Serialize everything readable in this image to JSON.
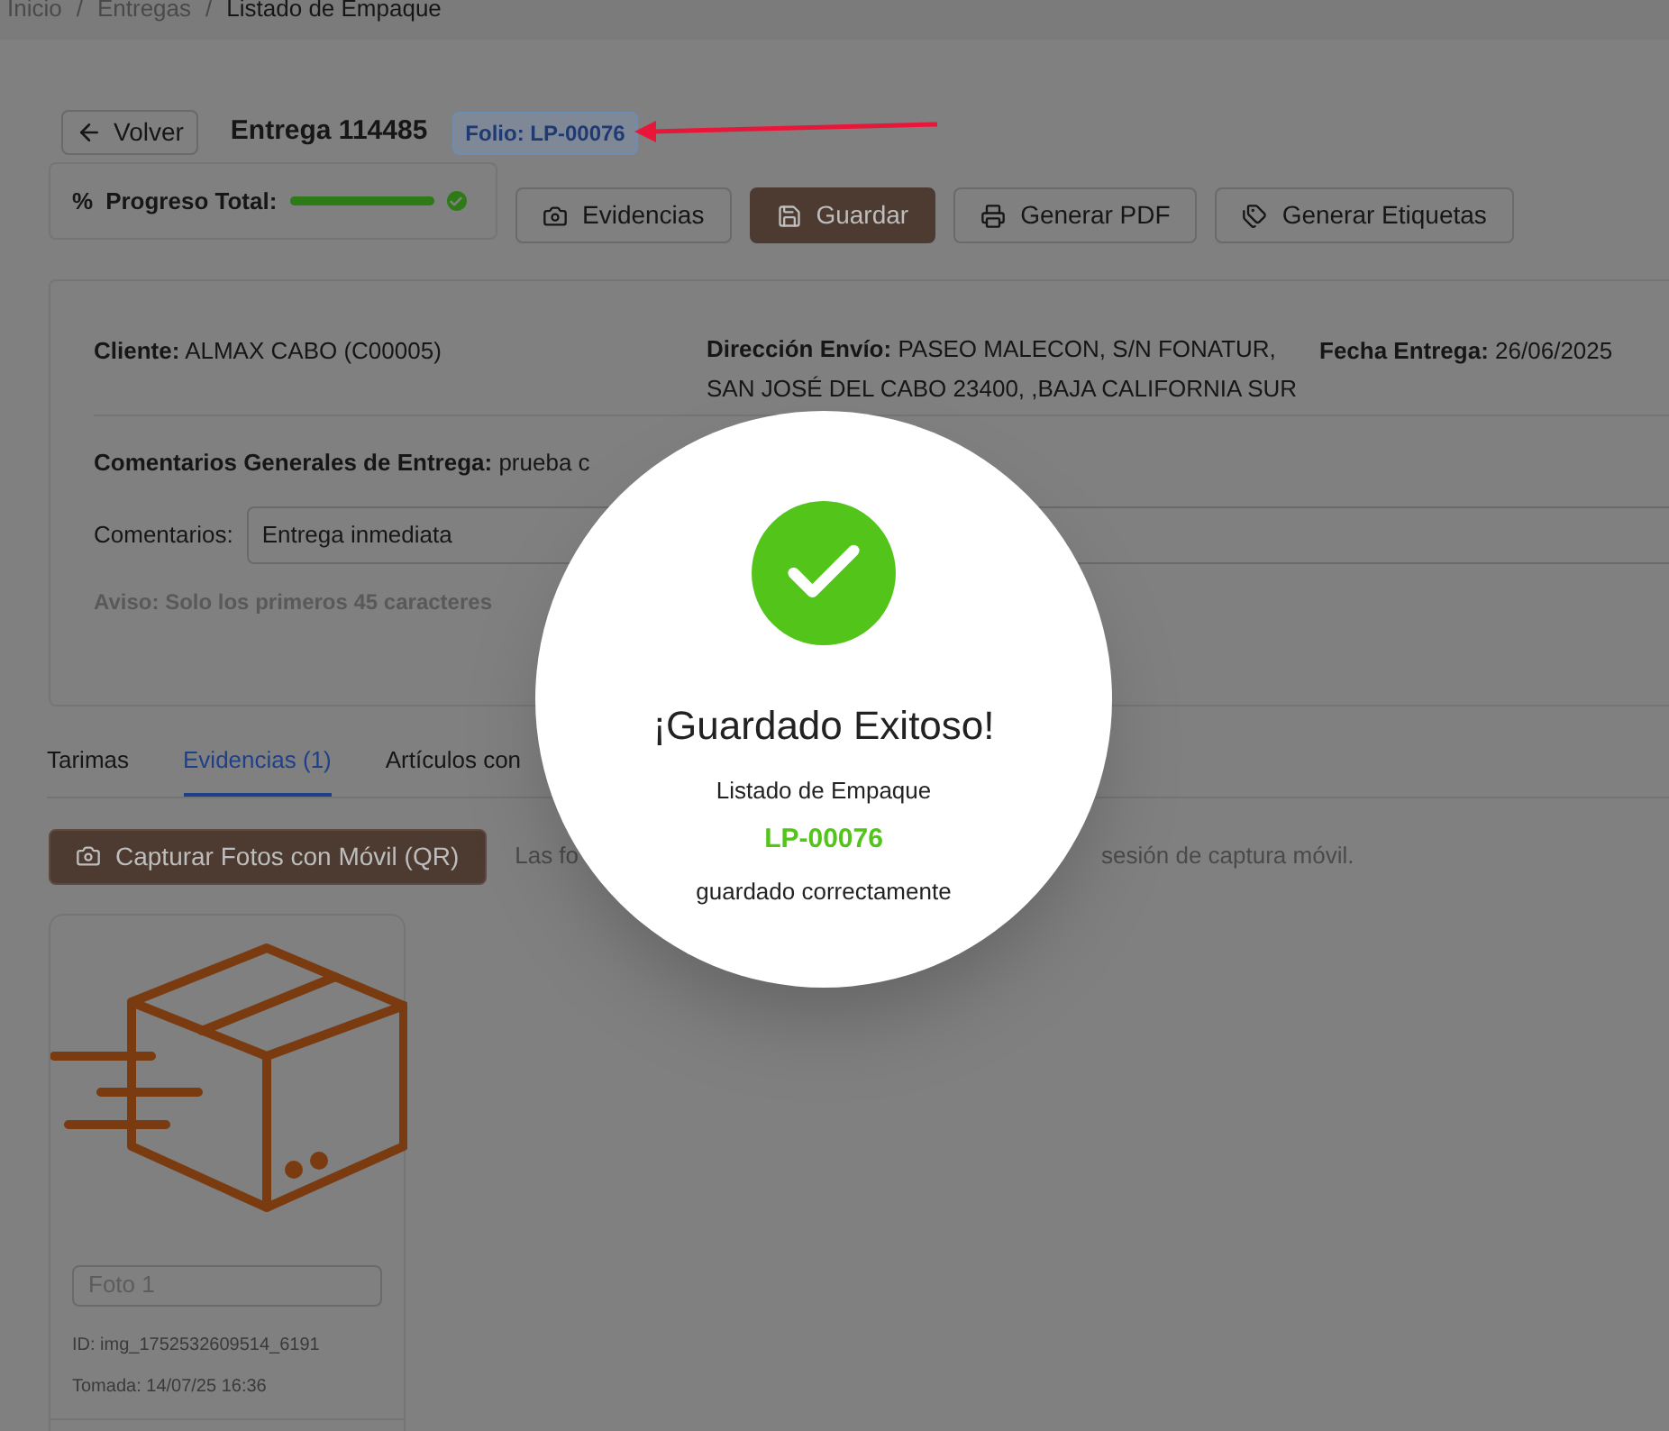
{
  "breadcrumb": [
    {
      "label": "Inicio",
      "separator": "/"
    },
    {
      "label": "Entregas",
      "separator": "/"
    },
    {
      "label": "Listado de Empaque"
    }
  ],
  "header": {
    "back_button": "Volver",
    "title": "Entrega 114485",
    "folio": "Folio: LP-00076"
  },
  "progress": {
    "icon": "%",
    "label": "Progreso Total:",
    "level": 1.0,
    "complete": true
  },
  "actions": [
    {
      "label": "Evidencias",
      "kind": "outline"
    },
    {
      "label": "Guardar",
      "kind": "primary"
    },
    {
      "label": "Generar PDF",
      "kind": "outline"
    },
    {
      "label": "Generar Etiquetas",
      "kind": "outline"
    }
  ],
  "info": {
    "cliente": {
      "label": "Cliente:",
      "value": "ALMAX CABO (C00005)"
    },
    "direccion": {
      "label": "Dirección Envío:",
      "lines": [
        "PASEO MALECON, S/N FONATUR,",
        "SAN JOSÉ DEL CABO 23400, ,BAJA CALIFORNIA SUR"
      ]
    },
    "fecha": {
      "label": "Fecha Entrega:",
      "value": "26/06/2025"
    }
  },
  "general_comments": {
    "label": "Comentarios Generales de Entrega:",
    "value": "prueba c"
  },
  "comments_field": {
    "label": "Comentarios:",
    "value": "Entrega inmediata"
  },
  "notice": "Aviso: Solo los primeros 45 caracteres",
  "tabs": [
    {
      "label": "Tarimas",
      "selected": false
    },
    {
      "label": "Evidencias (1)",
      "selected": true
    },
    {
      "label": "Artículos con",
      "selected": false
    }
  ],
  "capture_button": "Capturar Fotos con Móvil (QR)",
  "capture_hint": [
    "Las fo",
    "sesión de captura móvil."
  ],
  "photos": [
    {
      "placeholder": "Foto 1",
      "id": "ID: img_1752532609514_6191",
      "taken": "Tomada: 14/07/25 16:36"
    }
  ],
  "modal": {
    "title": "¡Guardado Exitoso!",
    "subtitle": "Listado de Empaque",
    "folio": "LP-00076",
    "message": "guardado correctamente"
  }
}
